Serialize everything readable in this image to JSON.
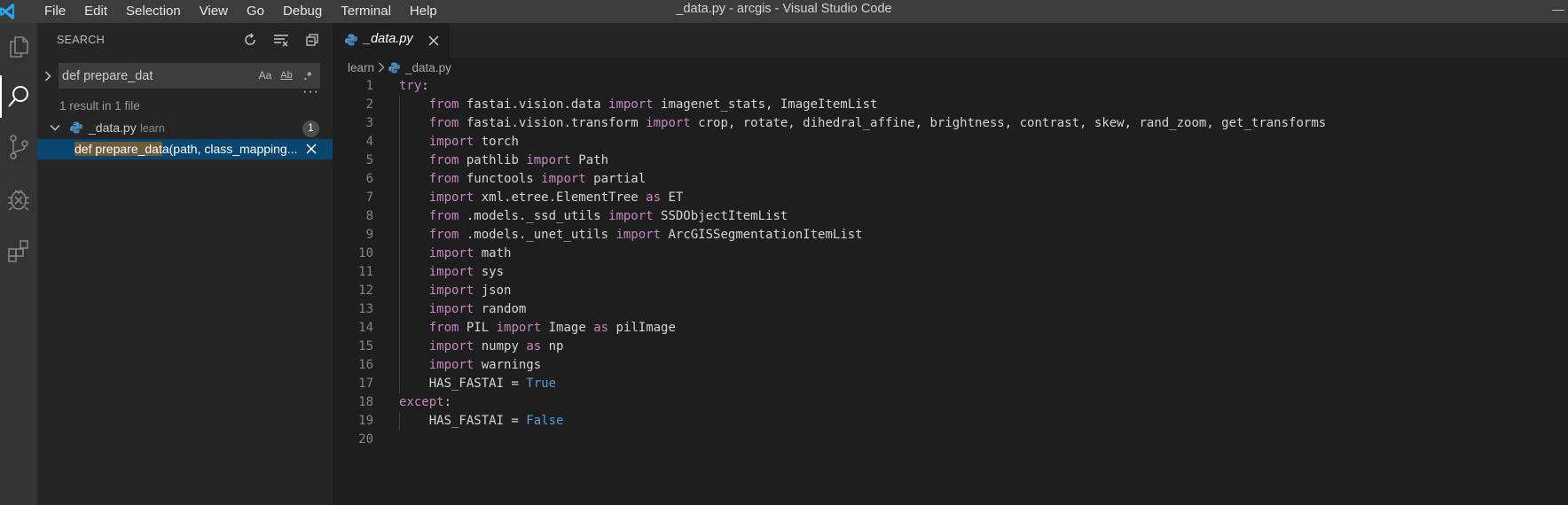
{
  "titlebar": {
    "menu": [
      "File",
      "Edit",
      "Selection",
      "View",
      "Go",
      "Debug",
      "Terminal",
      "Help"
    ],
    "window_title": "_data.py - arcgis - Visual Studio Code"
  },
  "activitybar": {
    "items": [
      "explorer-icon",
      "search-icon",
      "source-control-icon",
      "debug-icon",
      "extensions-icon"
    ],
    "active": "search-icon"
  },
  "sidebar": {
    "title": "SEARCH",
    "search": {
      "value": "def prepare_dat",
      "options": [
        "Aa",
        "Ab",
        ".*"
      ]
    },
    "result_summary": "1 result in 1 file",
    "file": {
      "name": "_data.py",
      "path": "learn",
      "count": "1"
    },
    "match": {
      "highlight": "def prepare_dat",
      "rest": "a(path, class_mapping..."
    }
  },
  "editor": {
    "tab": {
      "label": "_data.py"
    },
    "breadcrumb": {
      "folder": "learn",
      "file": "_data.py"
    },
    "lines": [
      {
        "n": "1",
        "indent": false,
        "parts": [
          [
            "kw",
            "try"
          ],
          [
            "",
            ":"
          ]
        ]
      },
      {
        "n": "2",
        "indent": true,
        "parts": [
          [
            "kw",
            "from"
          ],
          [
            "",
            " fastai.vision.data "
          ],
          [
            "kw",
            "import"
          ],
          [
            "",
            " imagenet_stats, ImageItemList"
          ]
        ]
      },
      {
        "n": "3",
        "indent": true,
        "parts": [
          [
            "kw",
            "from"
          ],
          [
            "",
            " fastai.vision.transform "
          ],
          [
            "kw",
            "import"
          ],
          [
            "",
            " crop, rotate, dihedral_affine, brightness, contrast, skew, rand_zoom, get_transforms"
          ]
        ]
      },
      {
        "n": "4",
        "indent": true,
        "parts": [
          [
            "kw",
            "import"
          ],
          [
            "",
            " torch"
          ]
        ]
      },
      {
        "n": "5",
        "indent": true,
        "parts": [
          [
            "kw",
            "from"
          ],
          [
            "",
            " pathlib "
          ],
          [
            "kw",
            "import"
          ],
          [
            "",
            " Path"
          ]
        ]
      },
      {
        "n": "6",
        "indent": true,
        "parts": [
          [
            "kw",
            "from"
          ],
          [
            "",
            " functools "
          ],
          [
            "kw",
            "import"
          ],
          [
            "",
            " partial"
          ]
        ]
      },
      {
        "n": "7",
        "indent": true,
        "parts": [
          [
            "kw",
            "import"
          ],
          [
            "",
            " xml.etree.ElementTree "
          ],
          [
            "kw",
            "as"
          ],
          [
            "",
            " ET"
          ]
        ]
      },
      {
        "n": "8",
        "indent": true,
        "parts": [
          [
            "kw",
            "from"
          ],
          [
            "",
            " .models._ssd_utils "
          ],
          [
            "kw",
            "import"
          ],
          [
            "",
            " SSDObjectItemList"
          ]
        ]
      },
      {
        "n": "9",
        "indent": true,
        "parts": [
          [
            "kw",
            "from"
          ],
          [
            "",
            " .models._unet_utils "
          ],
          [
            "kw",
            "import"
          ],
          [
            "",
            " ArcGISSegmentationItemList"
          ]
        ]
      },
      {
        "n": "10",
        "indent": true,
        "parts": [
          [
            "kw",
            "import"
          ],
          [
            "",
            " math"
          ]
        ]
      },
      {
        "n": "11",
        "indent": true,
        "parts": [
          [
            "kw",
            "import"
          ],
          [
            "",
            " sys"
          ]
        ]
      },
      {
        "n": "12",
        "indent": true,
        "parts": [
          [
            "kw",
            "import"
          ],
          [
            "",
            " json"
          ]
        ]
      },
      {
        "n": "13",
        "indent": true,
        "parts": [
          [
            "kw",
            "import"
          ],
          [
            "",
            " random"
          ]
        ]
      },
      {
        "n": "14",
        "indent": true,
        "parts": [
          [
            "kw",
            "from"
          ],
          [
            "",
            " PIL "
          ],
          [
            "kw",
            "import"
          ],
          [
            "",
            " Image "
          ],
          [
            "kw",
            "as"
          ],
          [
            "",
            " pilImage"
          ]
        ]
      },
      {
        "n": "15",
        "indent": true,
        "parts": [
          [
            "kw",
            "import"
          ],
          [
            "",
            " numpy "
          ],
          [
            "kw",
            "as"
          ],
          [
            "",
            " np"
          ]
        ]
      },
      {
        "n": "16",
        "indent": true,
        "parts": [
          [
            "kw",
            "import"
          ],
          [
            "",
            " warnings"
          ]
        ]
      },
      {
        "n": "17",
        "indent": true,
        "parts": [
          [
            "",
            "HAS_FASTAI = "
          ],
          [
            "const",
            "True"
          ]
        ]
      },
      {
        "n": "18",
        "indent": false,
        "parts": [
          [
            "kw",
            "except"
          ],
          [
            "",
            ":"
          ]
        ]
      },
      {
        "n": "19",
        "indent": true,
        "parts": [
          [
            "",
            "HAS_FASTAI = "
          ],
          [
            "const",
            "False"
          ]
        ]
      },
      {
        "n": "20",
        "indent": false,
        "parts": []
      }
    ]
  }
}
